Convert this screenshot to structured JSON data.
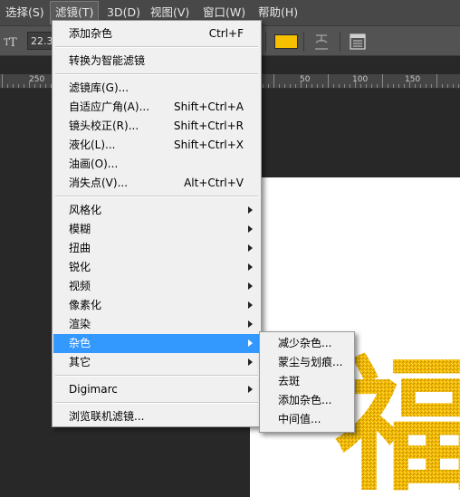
{
  "menubar": {
    "items": [
      "选择(S)",
      "滤镜(T)",
      "3D(D)",
      "视图(V)",
      "窗口(W)",
      "帮助(H)"
    ]
  },
  "options_bar": {
    "font_size": "22.3",
    "color_swatch": "#f5c000"
  },
  "ruler": {
    "labels": [
      "250",
      "50",
      "100",
      "150"
    ]
  },
  "filter_menu": {
    "last_filter": {
      "label": "添加杂色",
      "shortcut": "Ctrl+F"
    },
    "convert_smart": "转换为智能滤镜",
    "group1": [
      {
        "label": "滤镜库(G)...",
        "shortcut": ""
      },
      {
        "label": "自适应广角(A)...",
        "shortcut": "Shift+Ctrl+A"
      },
      {
        "label": "镜头校正(R)...",
        "shortcut": "Shift+Ctrl+R"
      },
      {
        "label": "液化(L)...",
        "shortcut": "Shift+Ctrl+X"
      },
      {
        "label": "油画(O)...",
        "shortcut": ""
      },
      {
        "label": "消失点(V)...",
        "shortcut": "Alt+Ctrl+V"
      }
    ],
    "submenus": [
      "风格化",
      "模糊",
      "扭曲",
      "锐化",
      "视频",
      "像素化",
      "渲染",
      "杂色",
      "其它"
    ],
    "digimarc": "Digimarc",
    "browse_online": "浏览联机滤镜..."
  },
  "noise_submenu": {
    "items": [
      "减少杂色...",
      "蒙尘与划痕...",
      "去斑",
      "添加杂色...",
      "中间值..."
    ]
  },
  "canvas_text": {
    "glyph": "福",
    "color": "#f0b800"
  }
}
